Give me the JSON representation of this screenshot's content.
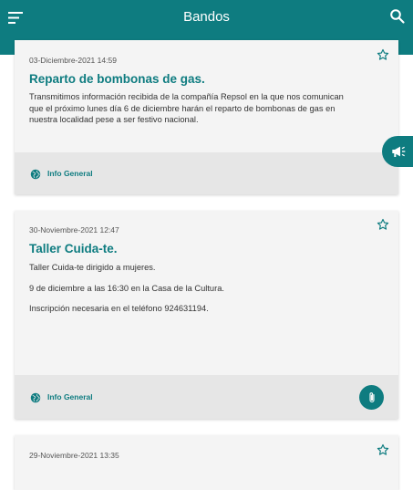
{
  "app": {
    "title": "Bandos",
    "accent_color": "#0e7c80",
    "menu_icon": "menu-icon",
    "search_icon": "search-icon",
    "side_button_icon": "megaphone-icon"
  },
  "bandos": [
    {
      "date": "03-Diciembre-2021 14:59",
      "title": "Reparto de bombonas de gas.",
      "paragraphs": [
        "Transmitimos información recibida de la compañía Repsol en la que nos comunican que el próximo lunes día 6 de diciembre harán el reparto de bombonas de gas en nuestra localidad pese a ser festivo nacional."
      ],
      "category": "Info General",
      "has_attachment": false
    },
    {
      "date": "30-Noviembre-2021 12:47",
      "title": "Taller Cuida-te.",
      "paragraphs": [
        "Taller Cuida-te dirigido a mujeres.",
        "9 de diciembre a las 16:30 en la Casa de la Cultura.",
        "Inscripción necesaria en el teléfono 924631194."
      ],
      "category": "Info General",
      "has_attachment": true
    },
    {
      "date": "29-Noviembre-2021 13:35"
    }
  ]
}
